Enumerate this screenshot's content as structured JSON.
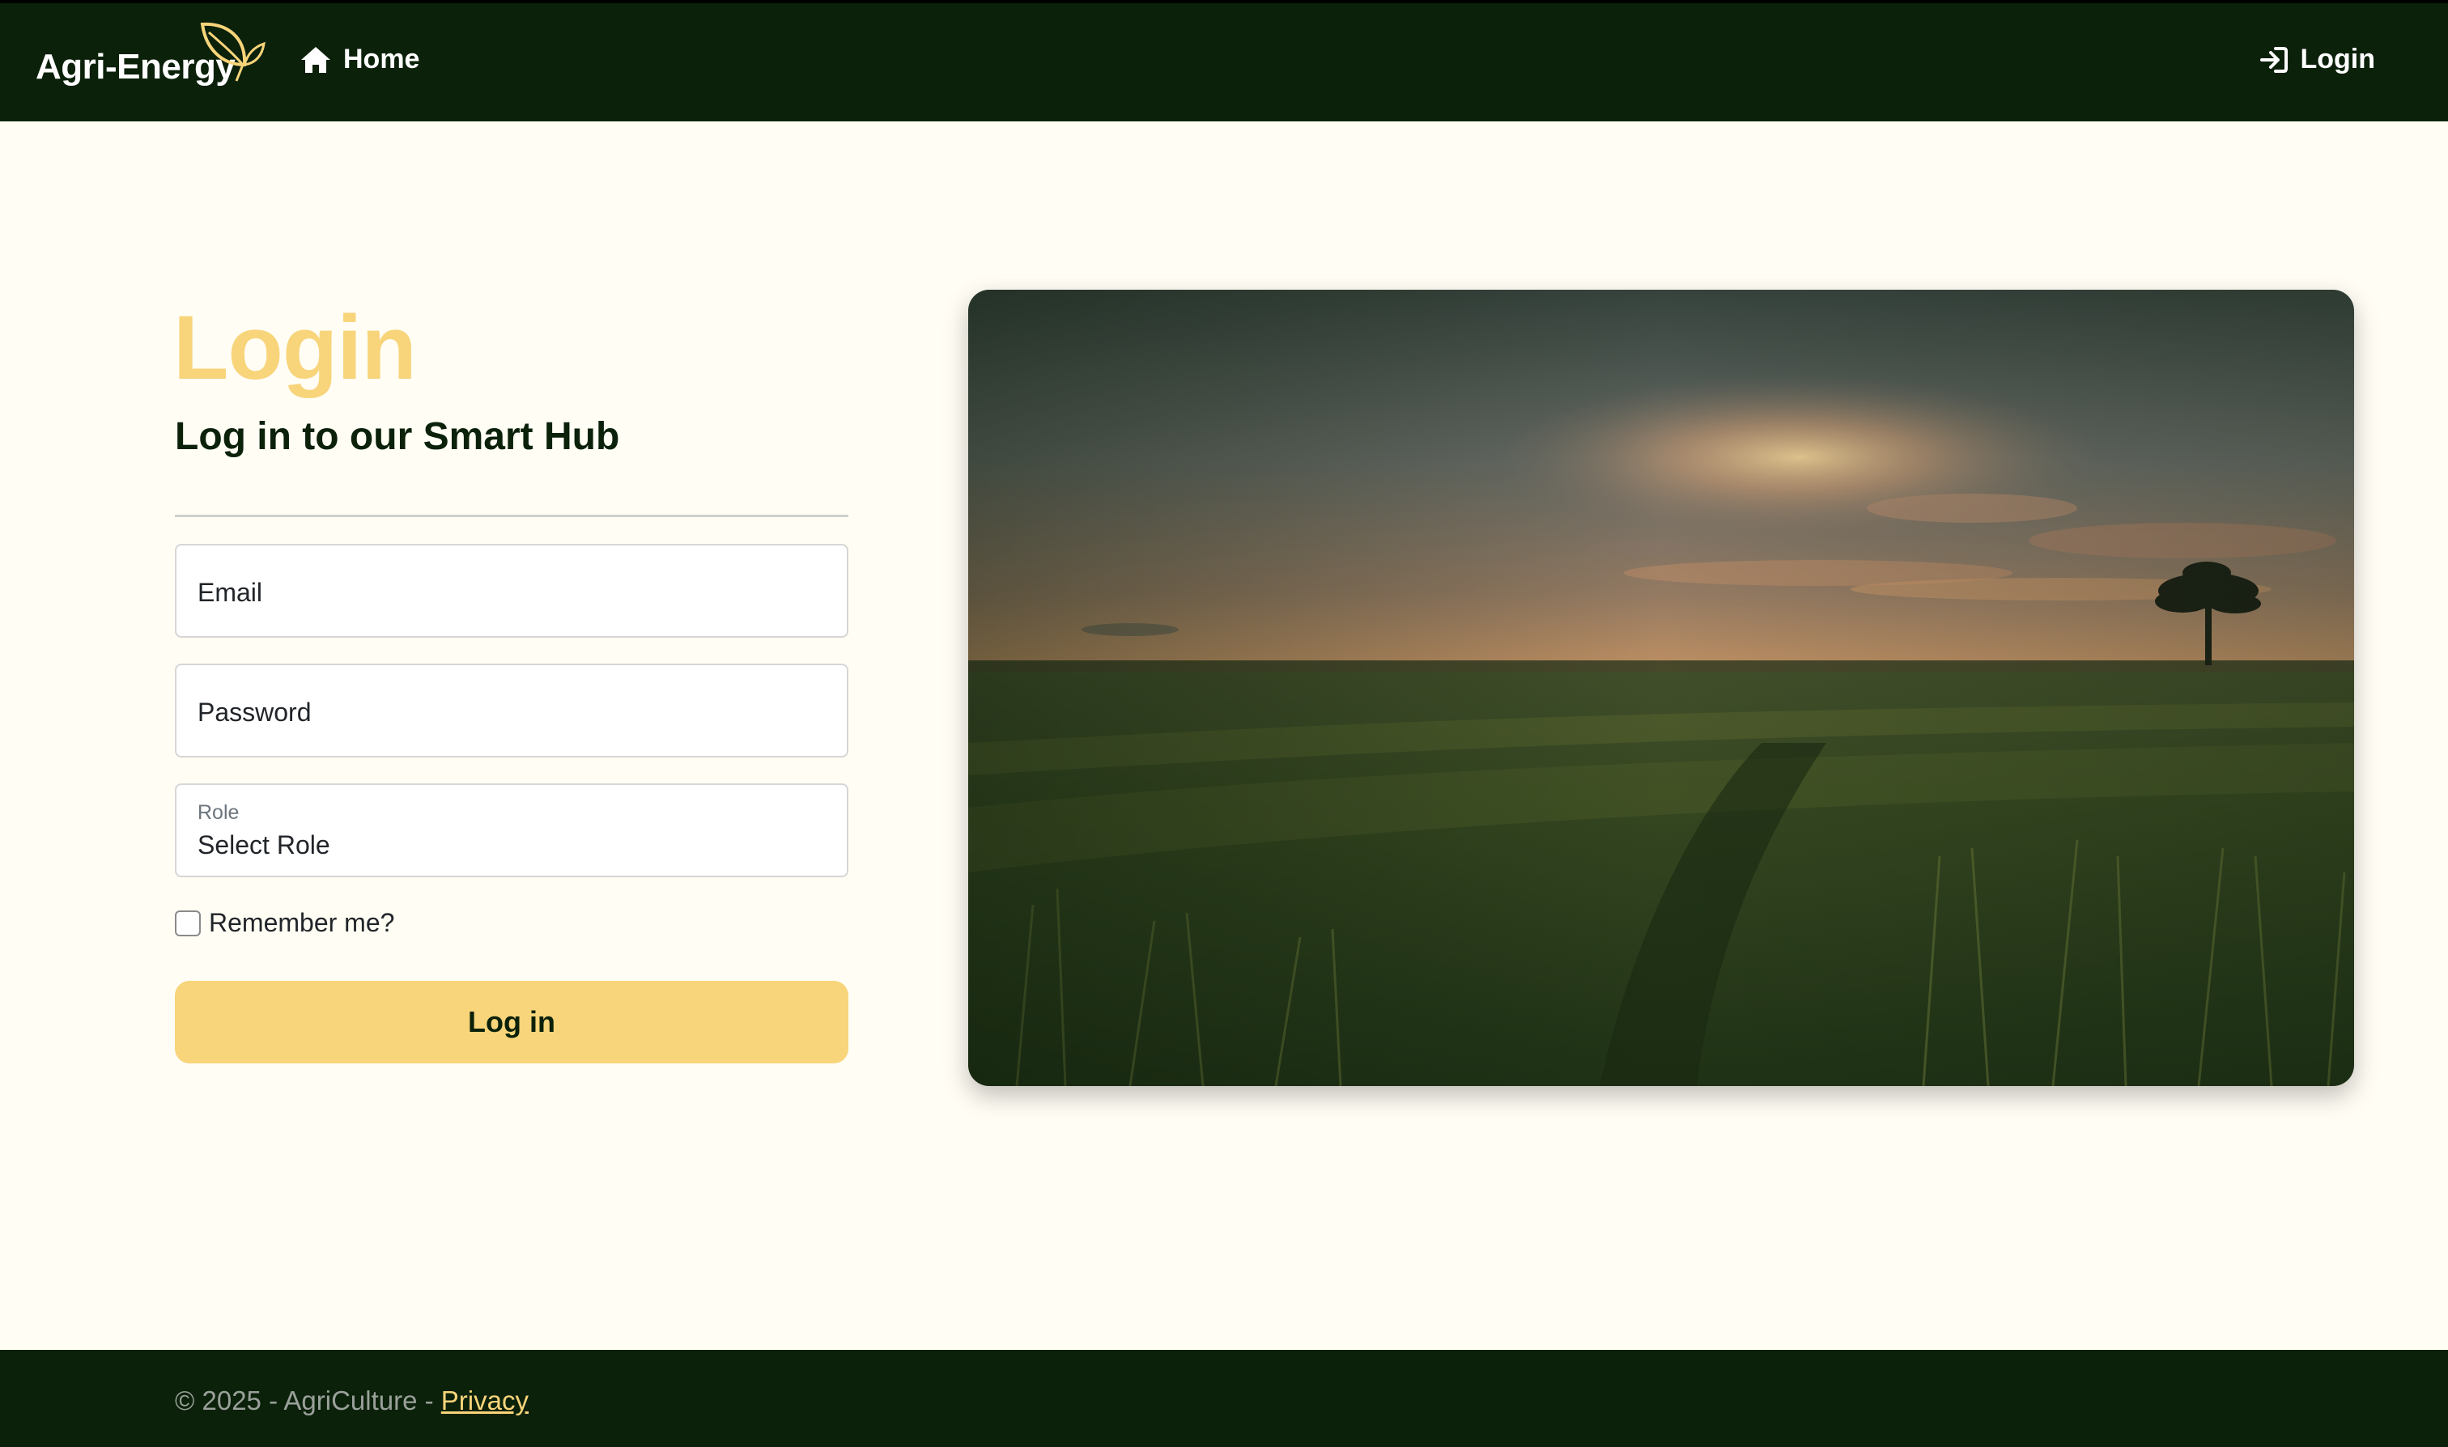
{
  "navbar": {
    "brand": "Agri-Energy",
    "home_label": "Home",
    "login_label": "Login"
  },
  "main": {
    "heading": "Login",
    "subheading": "Log in to our Smart Hub",
    "form": {
      "email_label": "Email",
      "password_label": "Password",
      "role_label": "Role",
      "role_value": "Select Role",
      "remember_label": "Remember me?",
      "submit_label": "Log in"
    }
  },
  "footer": {
    "copyright": "© 2025 - AgriCulture - ",
    "privacy_label": "Privacy"
  },
  "colors": {
    "navbar_bg": "#0b210a",
    "accent": "#f8d47a",
    "page_bg": "#fffdf4"
  },
  "icons": {
    "brand": "leaf-icon",
    "home": "home-icon",
    "login": "sign-in-icon"
  }
}
